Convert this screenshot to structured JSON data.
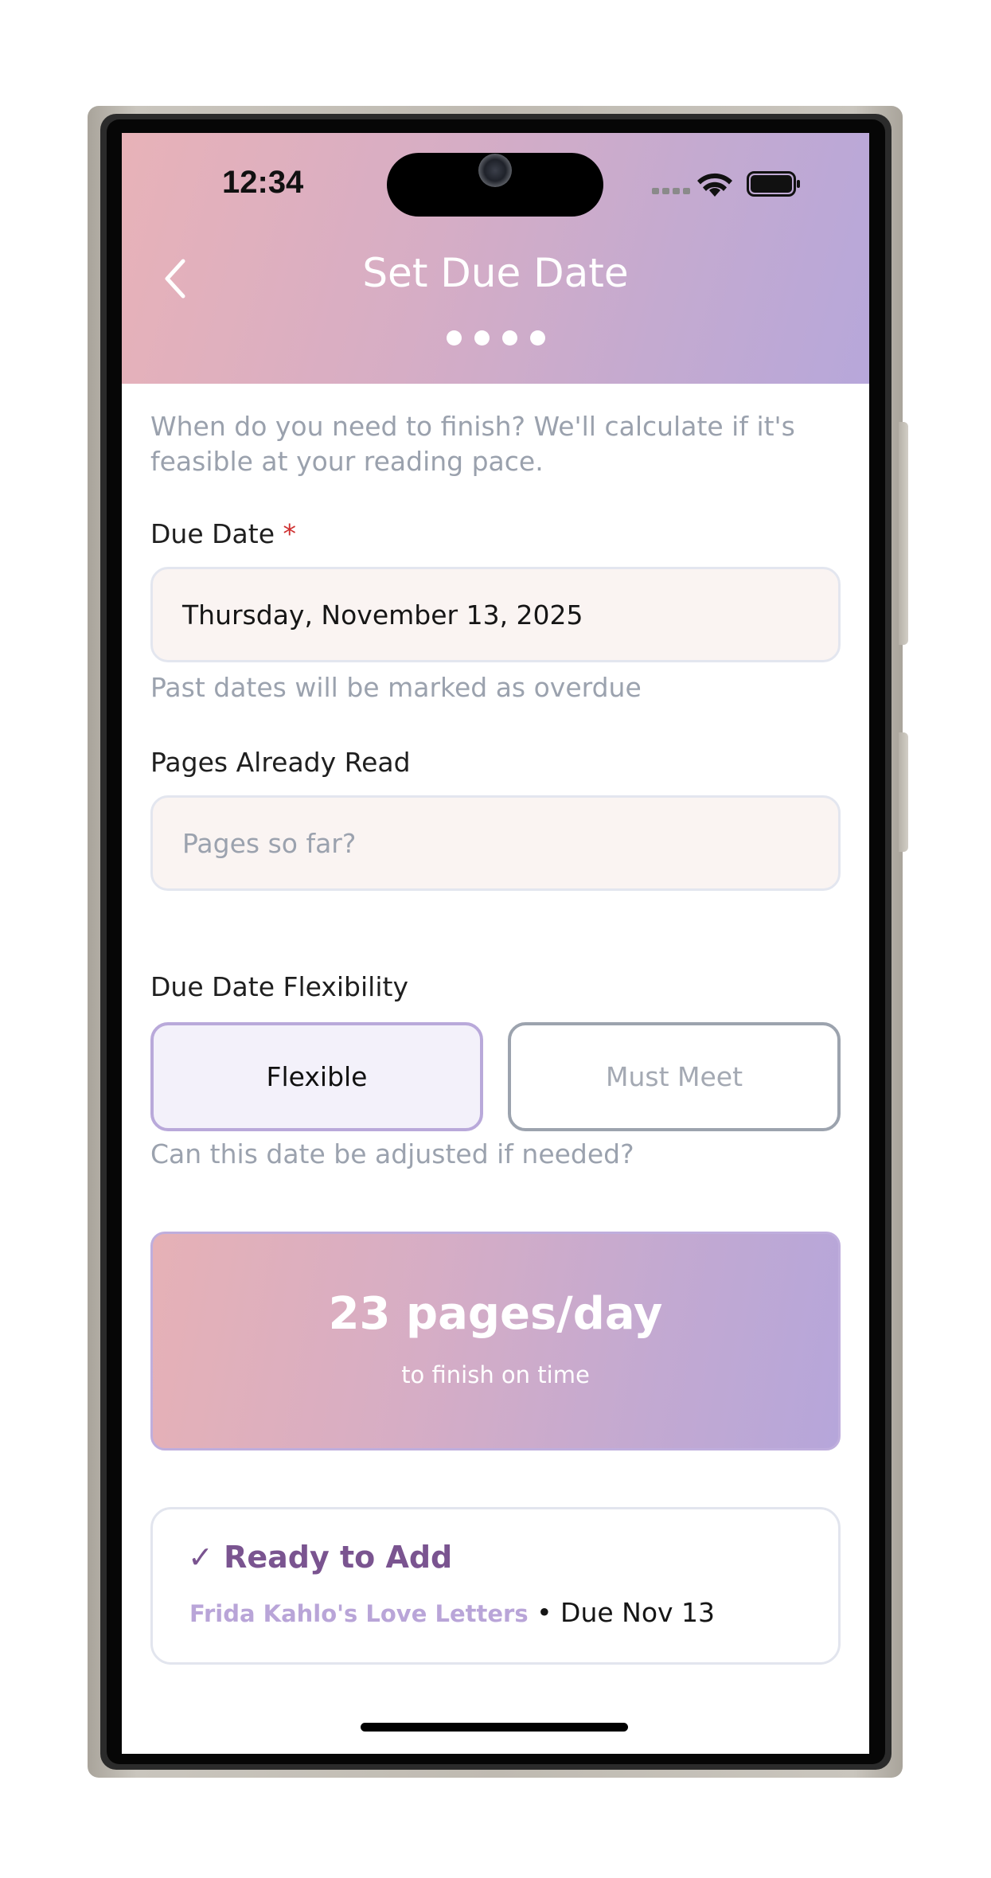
{
  "status_bar": {
    "time": "12:34",
    "icons": [
      "cellular-signal-icon",
      "wifi-icon",
      "battery-icon"
    ]
  },
  "header": {
    "title": "Set Due Date",
    "back_icon": "chevron-left-icon",
    "steps": {
      "total": 4,
      "current": 4
    },
    "gradient": [
      "#e8b2b8",
      "#b7a7da"
    ]
  },
  "intro": {
    "text": "When do you need to finish? We'll calculate if it's feasible at your reading pace."
  },
  "due_date": {
    "label": "Due Date",
    "required_mark": "*",
    "value": "Thursday, November 13, 2025",
    "helper": "Past dates will be marked as overdue"
  },
  "pages_read": {
    "label": "Pages Already Read",
    "value": "",
    "placeholder": "Pages so far?"
  },
  "flexibility": {
    "label": "Due Date Flexibility",
    "options": [
      {
        "label": "Flexible",
        "selected": true
      },
      {
        "label": "Must Meet",
        "selected": false
      }
    ],
    "helper": "Can this date be adjusted if needed?"
  },
  "pace": {
    "value": "23 pages/day",
    "caption": "to finish on time"
  },
  "ready": {
    "title": "✓ Ready to Add",
    "book_title": "Frida Kahlo's Love Letters",
    "separator": " • ",
    "due_text": "Due Nov 13"
  },
  "colors": {
    "accent": "#b9a9da",
    "ready_title": "#7a5490",
    "required": "#cf3030",
    "muted_text": "#9ba2ae"
  }
}
